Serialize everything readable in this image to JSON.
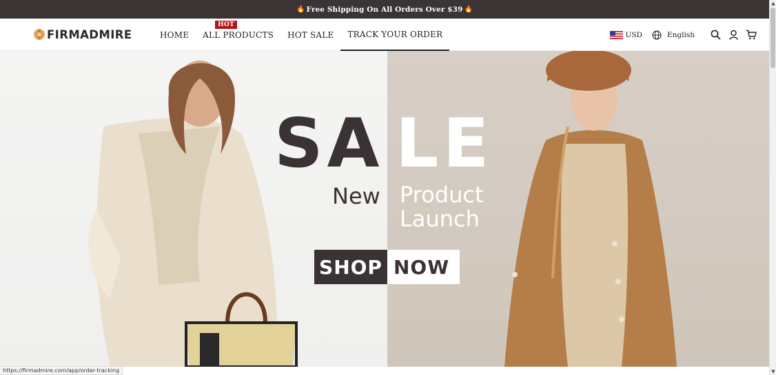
{
  "announcement": {
    "text": "Free Shipping On All Orders Over $39",
    "flame_left": "🔥",
    "flame_right": "🔥"
  },
  "header": {
    "logo": "FIRMADMIRE",
    "nav": [
      {
        "label": "HOME"
      },
      {
        "label": "ALL PRODUCTS",
        "badge": "HOT"
      },
      {
        "label": "HOT SALE"
      },
      {
        "label": "TRACK YOUR ORDER",
        "active": true
      }
    ],
    "currency": "USD",
    "language": "English",
    "icons": [
      "search-icon",
      "account-icon",
      "cart-icon"
    ]
  },
  "hero": {
    "sale_dark": "SA",
    "sale_light": "LE",
    "sub_dark": "New",
    "sub_light_1": "Product",
    "sub_light_2": "Launch",
    "shop": "SHOP",
    "now": "NOW"
  },
  "status_url": "https://firmadmire.com/app/order-tracking",
  "colors": {
    "announcement_bg": "#3a3434",
    "hot_badge": "#b3131b",
    "dark_text": "#3b3333",
    "hero_right_bg": "#d7cfc6"
  }
}
